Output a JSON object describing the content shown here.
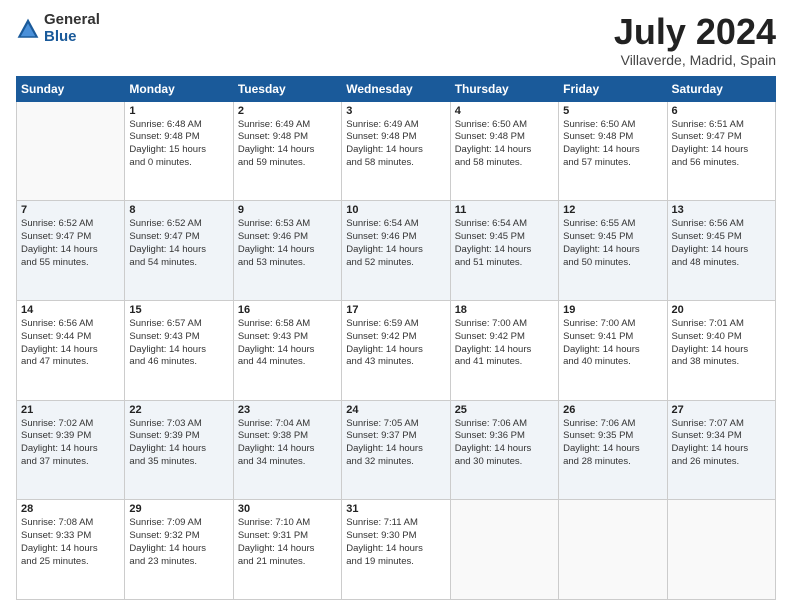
{
  "logo": {
    "general": "General",
    "blue": "Blue"
  },
  "header": {
    "month": "July 2024",
    "location": "Villaverde, Madrid, Spain"
  },
  "days": [
    "Sunday",
    "Monday",
    "Tuesday",
    "Wednesday",
    "Thursday",
    "Friday",
    "Saturday"
  ],
  "weeks": [
    [
      {
        "num": "",
        "sunrise": "",
        "sunset": "",
        "daylight": "",
        "shade": false
      },
      {
        "num": "1",
        "sunrise": "Sunrise: 6:48 AM",
        "sunset": "Sunset: 9:48 PM",
        "daylight": "Daylight: 15 hours",
        "daylight2": "and 0 minutes.",
        "shade": false
      },
      {
        "num": "2",
        "sunrise": "Sunrise: 6:49 AM",
        "sunset": "Sunset: 9:48 PM",
        "daylight": "Daylight: 14 hours",
        "daylight2": "and 59 minutes.",
        "shade": false
      },
      {
        "num": "3",
        "sunrise": "Sunrise: 6:49 AM",
        "sunset": "Sunset: 9:48 PM",
        "daylight": "Daylight: 14 hours",
        "daylight2": "and 58 minutes.",
        "shade": false
      },
      {
        "num": "4",
        "sunrise": "Sunrise: 6:50 AM",
        "sunset": "Sunset: 9:48 PM",
        "daylight": "Daylight: 14 hours",
        "daylight2": "and 58 minutes.",
        "shade": false
      },
      {
        "num": "5",
        "sunrise": "Sunrise: 6:50 AM",
        "sunset": "Sunset: 9:48 PM",
        "daylight": "Daylight: 14 hours",
        "daylight2": "and 57 minutes.",
        "shade": false
      },
      {
        "num": "6",
        "sunrise": "Sunrise: 6:51 AM",
        "sunset": "Sunset: 9:47 PM",
        "daylight": "Daylight: 14 hours",
        "daylight2": "and 56 minutes.",
        "shade": false
      }
    ],
    [
      {
        "num": "7",
        "sunrise": "Sunrise: 6:52 AM",
        "sunset": "Sunset: 9:47 PM",
        "daylight": "Daylight: 14 hours",
        "daylight2": "and 55 minutes.",
        "shade": true
      },
      {
        "num": "8",
        "sunrise": "Sunrise: 6:52 AM",
        "sunset": "Sunset: 9:47 PM",
        "daylight": "Daylight: 14 hours",
        "daylight2": "and 54 minutes.",
        "shade": true
      },
      {
        "num": "9",
        "sunrise": "Sunrise: 6:53 AM",
        "sunset": "Sunset: 9:46 PM",
        "daylight": "Daylight: 14 hours",
        "daylight2": "and 53 minutes.",
        "shade": true
      },
      {
        "num": "10",
        "sunrise": "Sunrise: 6:54 AM",
        "sunset": "Sunset: 9:46 PM",
        "daylight": "Daylight: 14 hours",
        "daylight2": "and 52 minutes.",
        "shade": true
      },
      {
        "num": "11",
        "sunrise": "Sunrise: 6:54 AM",
        "sunset": "Sunset: 9:45 PM",
        "daylight": "Daylight: 14 hours",
        "daylight2": "and 51 minutes.",
        "shade": true
      },
      {
        "num": "12",
        "sunrise": "Sunrise: 6:55 AM",
        "sunset": "Sunset: 9:45 PM",
        "daylight": "Daylight: 14 hours",
        "daylight2": "and 50 minutes.",
        "shade": true
      },
      {
        "num": "13",
        "sunrise": "Sunrise: 6:56 AM",
        "sunset": "Sunset: 9:45 PM",
        "daylight": "Daylight: 14 hours",
        "daylight2": "and 48 minutes.",
        "shade": true
      }
    ],
    [
      {
        "num": "14",
        "sunrise": "Sunrise: 6:56 AM",
        "sunset": "Sunset: 9:44 PM",
        "daylight": "Daylight: 14 hours",
        "daylight2": "and 47 minutes.",
        "shade": false
      },
      {
        "num": "15",
        "sunrise": "Sunrise: 6:57 AM",
        "sunset": "Sunset: 9:43 PM",
        "daylight": "Daylight: 14 hours",
        "daylight2": "and 46 minutes.",
        "shade": false
      },
      {
        "num": "16",
        "sunrise": "Sunrise: 6:58 AM",
        "sunset": "Sunset: 9:43 PM",
        "daylight": "Daylight: 14 hours",
        "daylight2": "and 44 minutes.",
        "shade": false
      },
      {
        "num": "17",
        "sunrise": "Sunrise: 6:59 AM",
        "sunset": "Sunset: 9:42 PM",
        "daylight": "Daylight: 14 hours",
        "daylight2": "and 43 minutes.",
        "shade": false
      },
      {
        "num": "18",
        "sunrise": "Sunrise: 7:00 AM",
        "sunset": "Sunset: 9:42 PM",
        "daylight": "Daylight: 14 hours",
        "daylight2": "and 41 minutes.",
        "shade": false
      },
      {
        "num": "19",
        "sunrise": "Sunrise: 7:00 AM",
        "sunset": "Sunset: 9:41 PM",
        "daylight": "Daylight: 14 hours",
        "daylight2": "and 40 minutes.",
        "shade": false
      },
      {
        "num": "20",
        "sunrise": "Sunrise: 7:01 AM",
        "sunset": "Sunset: 9:40 PM",
        "daylight": "Daylight: 14 hours",
        "daylight2": "and 38 minutes.",
        "shade": false
      }
    ],
    [
      {
        "num": "21",
        "sunrise": "Sunrise: 7:02 AM",
        "sunset": "Sunset: 9:39 PM",
        "daylight": "Daylight: 14 hours",
        "daylight2": "and 37 minutes.",
        "shade": true
      },
      {
        "num": "22",
        "sunrise": "Sunrise: 7:03 AM",
        "sunset": "Sunset: 9:39 PM",
        "daylight": "Daylight: 14 hours",
        "daylight2": "and 35 minutes.",
        "shade": true
      },
      {
        "num": "23",
        "sunrise": "Sunrise: 7:04 AM",
        "sunset": "Sunset: 9:38 PM",
        "daylight": "Daylight: 14 hours",
        "daylight2": "and 34 minutes.",
        "shade": true
      },
      {
        "num": "24",
        "sunrise": "Sunrise: 7:05 AM",
        "sunset": "Sunset: 9:37 PM",
        "daylight": "Daylight: 14 hours",
        "daylight2": "and 32 minutes.",
        "shade": true
      },
      {
        "num": "25",
        "sunrise": "Sunrise: 7:06 AM",
        "sunset": "Sunset: 9:36 PM",
        "daylight": "Daylight: 14 hours",
        "daylight2": "and 30 minutes.",
        "shade": true
      },
      {
        "num": "26",
        "sunrise": "Sunrise: 7:06 AM",
        "sunset": "Sunset: 9:35 PM",
        "daylight": "Daylight: 14 hours",
        "daylight2": "and 28 minutes.",
        "shade": true
      },
      {
        "num": "27",
        "sunrise": "Sunrise: 7:07 AM",
        "sunset": "Sunset: 9:34 PM",
        "daylight": "Daylight: 14 hours",
        "daylight2": "and 26 minutes.",
        "shade": true
      }
    ],
    [
      {
        "num": "28",
        "sunrise": "Sunrise: 7:08 AM",
        "sunset": "Sunset: 9:33 PM",
        "daylight": "Daylight: 14 hours",
        "daylight2": "and 25 minutes.",
        "shade": false
      },
      {
        "num": "29",
        "sunrise": "Sunrise: 7:09 AM",
        "sunset": "Sunset: 9:32 PM",
        "daylight": "Daylight: 14 hours",
        "daylight2": "and 23 minutes.",
        "shade": false
      },
      {
        "num": "30",
        "sunrise": "Sunrise: 7:10 AM",
        "sunset": "Sunset: 9:31 PM",
        "daylight": "Daylight: 14 hours",
        "daylight2": "and 21 minutes.",
        "shade": false
      },
      {
        "num": "31",
        "sunrise": "Sunrise: 7:11 AM",
        "sunset": "Sunset: 9:30 PM",
        "daylight": "Daylight: 14 hours",
        "daylight2": "and 19 minutes.",
        "shade": false
      },
      {
        "num": "",
        "sunrise": "",
        "sunset": "",
        "daylight": "",
        "daylight2": "",
        "shade": false
      },
      {
        "num": "",
        "sunrise": "",
        "sunset": "",
        "daylight": "",
        "daylight2": "",
        "shade": false
      },
      {
        "num": "",
        "sunrise": "",
        "sunset": "",
        "daylight": "",
        "daylight2": "",
        "shade": false
      }
    ]
  ]
}
